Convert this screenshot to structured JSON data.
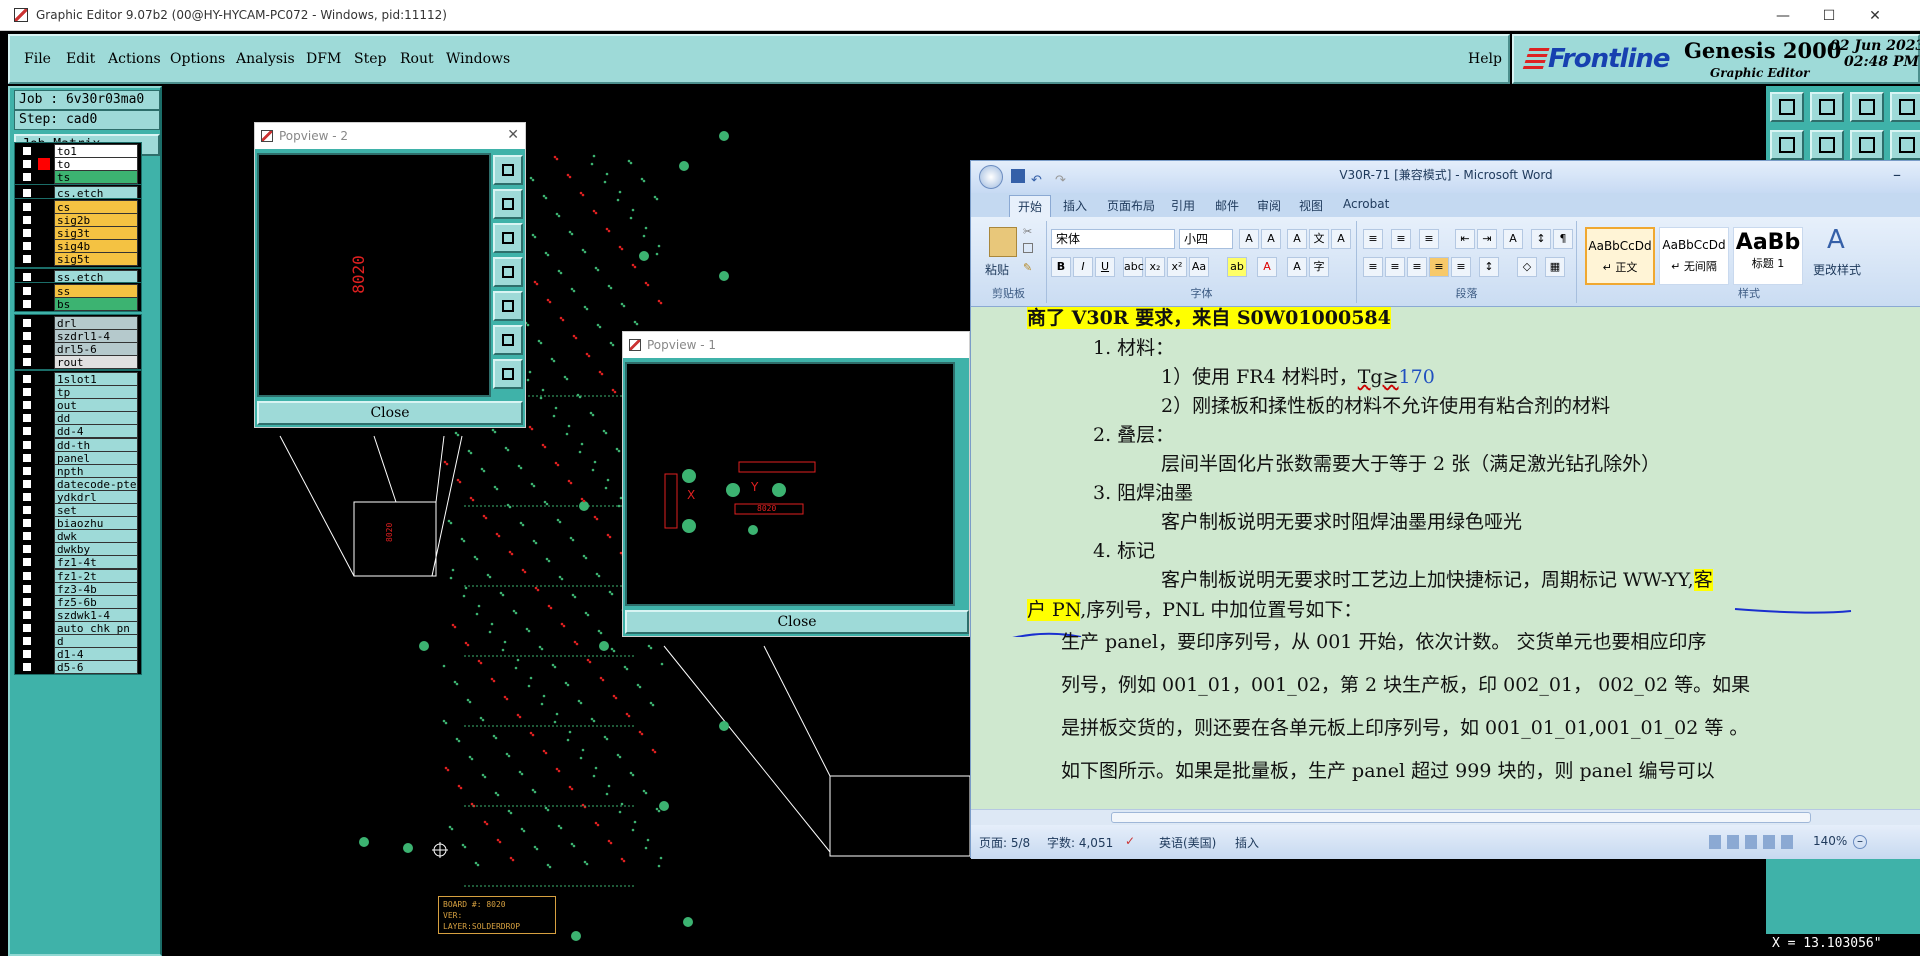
{
  "window": {
    "title": "Graphic Editor 9.07b2 (00@HY-HYCAM-PC072 - Windows, pid:11112)",
    "minimize": "—",
    "maximize": "☐",
    "close": "✕"
  },
  "menu": [
    "File",
    "Edit",
    "Actions",
    "Options",
    "Analysis",
    "DFM",
    "Step",
    "Rout",
    "Windows"
  ],
  "help": "Help",
  "brand": {
    "logo": "Frontline",
    "product": "Genesis 2000",
    "subtitle": "Graphic Editor",
    "date": "02 Jun 2023",
    "time": "02:48 PM"
  },
  "job": {
    "job_label": "Job : 6v30r03ma0",
    "step_label": "Step: cad0",
    "matrix_button": "Job Matrix ..."
  },
  "layers": [
    {
      "name": "to1",
      "color": "#ffffff",
      "swatch": "#000000"
    },
    {
      "name": "to",
      "color": "#ffffff",
      "swatch": "#ff0000"
    },
    {
      "name": "ts",
      "color": "#3cb371",
      "swatch": "#000000"
    },
    {
      "name": "cs.etch",
      "color": "#9edad8",
      "swatch": "#000000"
    },
    {
      "name": "cs",
      "color": "#f4c242",
      "swatch": "#000000"
    },
    {
      "name": "sig2b",
      "color": "#f4c242",
      "swatch": "#000000"
    },
    {
      "name": "sig3t",
      "color": "#f4c242",
      "swatch": "#000000"
    },
    {
      "name": "sig4b",
      "color": "#f4c242",
      "swatch": "#000000"
    },
    {
      "name": "sig5t",
      "color": "#f4c242",
      "swatch": "#000000"
    },
    {
      "name": "ss.etch",
      "color": "#9edad8",
      "swatch": "#000000"
    },
    {
      "name": "ss",
      "color": "#f4c242",
      "swatch": "#000000"
    },
    {
      "name": "bs",
      "color": "#3cb371",
      "swatch": "#000000"
    },
    {
      "name": "drl",
      "color": "#b5c9cc",
      "swatch": "#000000"
    },
    {
      "name": "szdrl1-4",
      "color": "#b5c9cc",
      "swatch": "#000000"
    },
    {
      "name": "drl5-6",
      "color": "#b5c9cc",
      "swatch": "#000000"
    },
    {
      "name": "rout",
      "color": "#e0e0e0",
      "swatch": "#000000"
    },
    {
      "name": "1slot1",
      "color": "#9edad8",
      "swatch": "#000000"
    },
    {
      "name": "tp",
      "color": "#9edad8",
      "swatch": "#000000"
    },
    {
      "name": "out",
      "color": "#9edad8",
      "swatch": "#000000"
    },
    {
      "name": "dd",
      "color": "#9edad8",
      "swatch": "#000000"
    },
    {
      "name": "dd-4",
      "color": "#9edad8",
      "swatch": "#000000"
    },
    {
      "name": "dd-th",
      "color": "#9edad8",
      "swatch": "#000000"
    },
    {
      "name": "panel",
      "color": "#9edad8",
      "swatch": "#000000"
    },
    {
      "name": "npth",
      "color": "#9edad8",
      "swatch": "#000000"
    },
    {
      "name": "datecode-pte",
      "color": "#9edad8",
      "swatch": "#000000"
    },
    {
      "name": "ydkdrl",
      "color": "#9edad8",
      "swatch": "#000000"
    },
    {
      "name": "set",
      "color": "#9edad8",
      "swatch": "#000000"
    },
    {
      "name": "biaozhu",
      "color": "#9edad8",
      "swatch": "#000000"
    },
    {
      "name": "dwk",
      "color": "#9edad8",
      "swatch": "#000000"
    },
    {
      "name": "dwkby",
      "color": "#9edad8",
      "swatch": "#000000"
    },
    {
      "name": "fz1-4t",
      "color": "#9edad8",
      "swatch": "#000000"
    },
    {
      "name": "fz1-2t",
      "color": "#9edad8",
      "swatch": "#000000"
    },
    {
      "name": "fz3-4b",
      "color": "#9edad8",
      "swatch": "#000000"
    },
    {
      "name": "fz5-6b",
      "color": "#9edad8",
      "swatch": "#000000"
    },
    {
      "name": "szdwk1-4",
      "color": "#9edad8",
      "swatch": "#000000"
    },
    {
      "name": "auto_chk_pn",
      "color": "#9edad8",
      "swatch": "#000000"
    },
    {
      "name": "d",
      "color": "#9edad8",
      "swatch": "#000000"
    },
    {
      "name": "d1-4",
      "color": "#9edad8",
      "swatch": "#000000"
    },
    {
      "name": "d5-6",
      "color": "#9edad8",
      "swatch": "#000000"
    }
  ],
  "popview2": {
    "title": "Popview - 2",
    "close": "Close",
    "label": "8020"
  },
  "popview1": {
    "title": "Popview - 1",
    "close": "Close",
    "label": "8020",
    "label_y": "Y",
    "label_x": "X"
  },
  "board_info": {
    "line1": "BOARD #: 8020",
    "line2": "VER:",
    "line3": "LAYER:SOLDERDROP"
  },
  "coord": "X = 13.103056\"",
  "word": {
    "title": "V30R-71 [兼容模式] - Microsoft Word",
    "tabs": [
      "开始",
      "插入",
      "页面布局",
      "引用",
      "邮件",
      "审阅",
      "视图",
      "Acrobat"
    ],
    "font_name": "宋体",
    "font_size": "小四",
    "groups": {
      "clipboard": "剪贴板",
      "font": "字体",
      "paragraph": "段落",
      "styles": "样式"
    },
    "paste": "粘贴",
    "styles": [
      {
        "preview": "AaBbCcDd",
        "name": "↵ 正文"
      },
      {
        "preview": "AaBbCcDd",
        "name": "↵ 无间隔"
      },
      {
        "preview": "AaBb",
        "name": "标题 1"
      }
    ],
    "change_styles": "更改样式",
    "doc": {
      "l0a": "商了 V30R 要求，",
      "l0b": "来自 S0W01000584",
      "l1": "1. 材料：",
      "l2a": "1）使用 FR4 材料时，",
      "l2b": "Tg≥",
      "l2c": "170",
      "l3": "2）刚揉板和揉性板的材料不允许使用有粘合剂的材料",
      "l4": "2. 叠层：",
      "l5": "层间半固化片张数需要大于等于 2 张（满足激光钻孔除外）",
      "l6": "3. 阻焊油墨",
      "l7": "客户制板说明无要求时阻焊油墨用绿色哑光",
      "l8": "4. 标记",
      "l9a": "客户制板说明无要求时工艺边上加快捷标记，周期标记 WW-YY,",
      "l9b": "客",
      "l10a": "户 PN",
      "l10b": ",序列号，PNL 中加位置号如下：",
      "l11": "生产 panel，要印序列号，从 001 开始，依次计数。  交货单元也要相应印序",
      "l12": "列号，例如 001_01，001_02，第 2 块生产板，印 002_01，  002_02 等。如果",
      "l13": "是拼板交货的，则还要在各单元板上印序列号，如 001_01_01,001_01_02 等  。",
      "l14": "如下图所示。如果是批量板，生产 panel 超过 999 块的，则 panel 编号可以"
    },
    "status": {
      "page": "页面: 5/8",
      "words": "字数: 4,051",
      "lang": "英语(美国)",
      "mode": "插入",
      "zoom": "140%"
    }
  }
}
